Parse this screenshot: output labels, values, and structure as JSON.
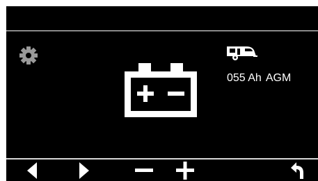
{
  "display": {
    "capacity": "055 Ah",
    "battery_type": "AGM"
  },
  "icons": {
    "settings": "gear-icon",
    "battery": "battery-icon",
    "vehicle": "caravan-icon",
    "prev": "arrow-left-icon",
    "next": "arrow-right-icon",
    "decrease": "minus-icon",
    "increase": "plus-icon",
    "back": "return-arrow-icon"
  },
  "colors": {
    "background": "#000000",
    "foreground": "#ffffff",
    "frame": "#ffffff"
  }
}
